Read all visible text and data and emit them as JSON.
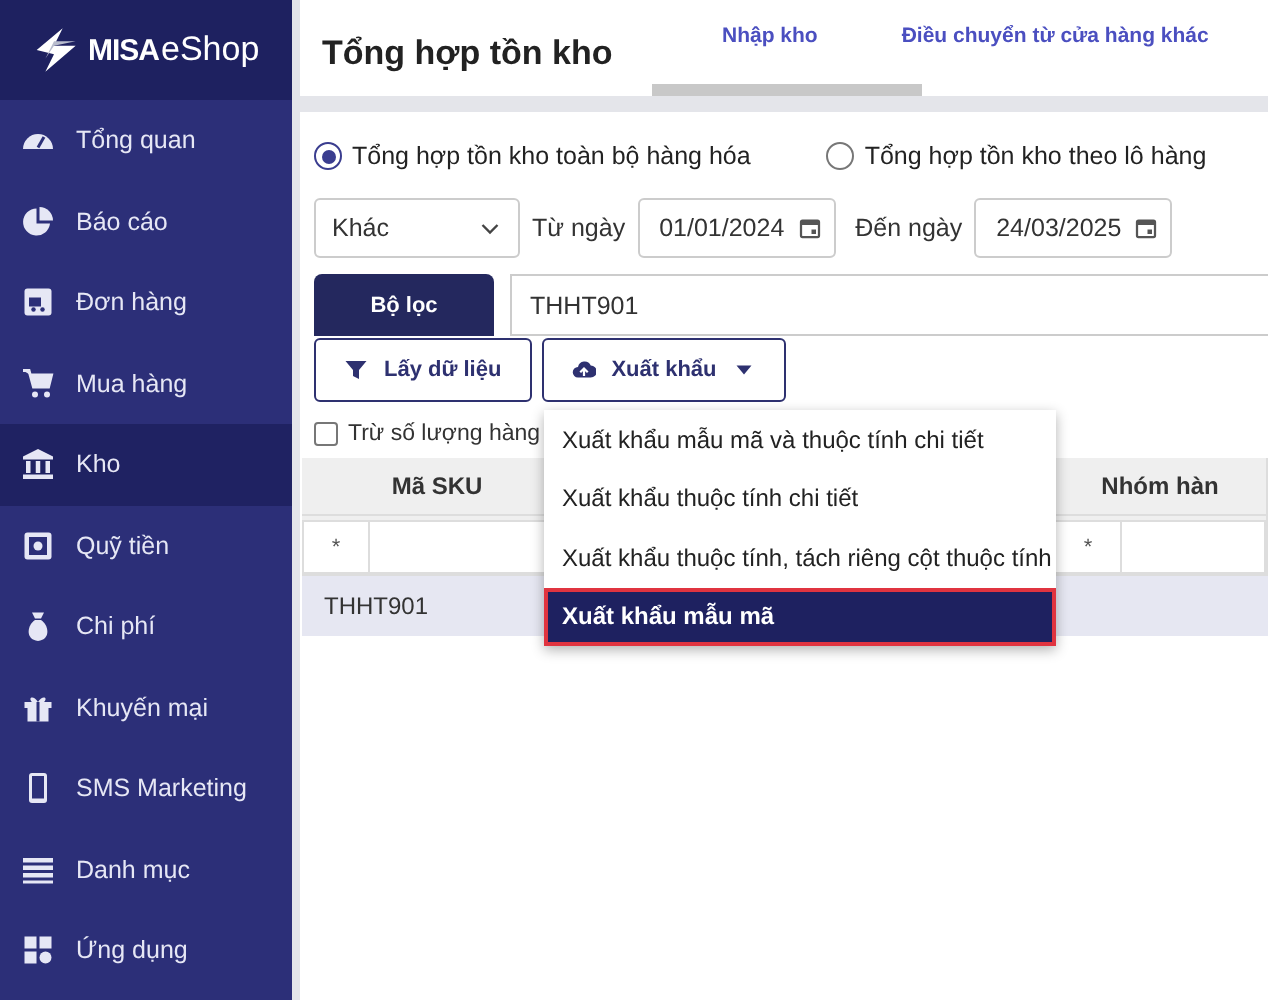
{
  "logo": {
    "brand": "MISA",
    "product": "eShop"
  },
  "sidebar": {
    "items": [
      {
        "label": "Tổng quan",
        "kind": "gauge",
        "selected": false
      },
      {
        "label": "Báo cáo",
        "kind": "pie",
        "selected": false
      },
      {
        "label": "Đơn hàng",
        "kind": "truck",
        "selected": false
      },
      {
        "label": "Mua hàng",
        "kind": "cart",
        "selected": false
      },
      {
        "label": "Kho",
        "kind": "bank",
        "selected": true
      },
      {
        "label": "Quỹ tiền",
        "kind": "safe",
        "selected": false
      },
      {
        "label": "Chi phí",
        "kind": "moneybag",
        "selected": false
      },
      {
        "label": "Khuyến mại",
        "kind": "gift",
        "selected": false
      },
      {
        "label": "SMS Marketing",
        "kind": "phone",
        "selected": false
      },
      {
        "label": "Danh mục",
        "kind": "list",
        "selected": false
      },
      {
        "label": "Ứng dụng",
        "kind": "apps",
        "selected": false
      }
    ]
  },
  "header": {
    "title": "Tổng hợp tồn kho",
    "tabs": [
      {
        "label": "Nhập kho"
      },
      {
        "label": "Điều chuyển từ cửa hàng khác"
      }
    ]
  },
  "report_type": [
    {
      "label": "Tổng hợp tồn kho toàn bộ hàng hóa",
      "selected": true
    },
    {
      "label": "Tổng hợp tồn kho theo lô hàng",
      "selected": false
    }
  ],
  "period": {
    "value": "Khác"
  },
  "from_date": {
    "label": "Từ ngày",
    "value": "01/01/2024"
  },
  "to_date": {
    "label": "Đến ngày",
    "value": "24/03/2025"
  },
  "filter": {
    "button": "Bộ lọc",
    "value": "THHT901"
  },
  "actions": [
    {
      "label": "Lấy dữ liệu",
      "kind": "filter"
    },
    {
      "label": "Xuất khẩu",
      "kind": "export"
    }
  ],
  "option": {
    "label": "Trừ số lượng hàng",
    "checked": false
  },
  "table": {
    "columns": [
      {
        "label": "Mã SKU",
        "filter_mark": "*"
      },
      {
        "label": "Nhóm hàn",
        "filter_mark": "*"
      }
    ],
    "rows": [
      {
        "cells": [
          "THHT901"
        ],
        "selected": true
      }
    ]
  },
  "export_menu": {
    "items": [
      {
        "label": "Xuất khẩu mẫu mã và thuộc tính chi tiết",
        "selected": false
      },
      {
        "label": "Xuất khẩu thuộc tính chi tiết",
        "selected": false
      },
      {
        "label": "Xuất khẩu thuộc tính, tách riêng cột thuộc tính",
        "selected": false
      },
      {
        "label": "Xuất khẩu mẫu mã",
        "selected": true
      }
    ]
  }
}
